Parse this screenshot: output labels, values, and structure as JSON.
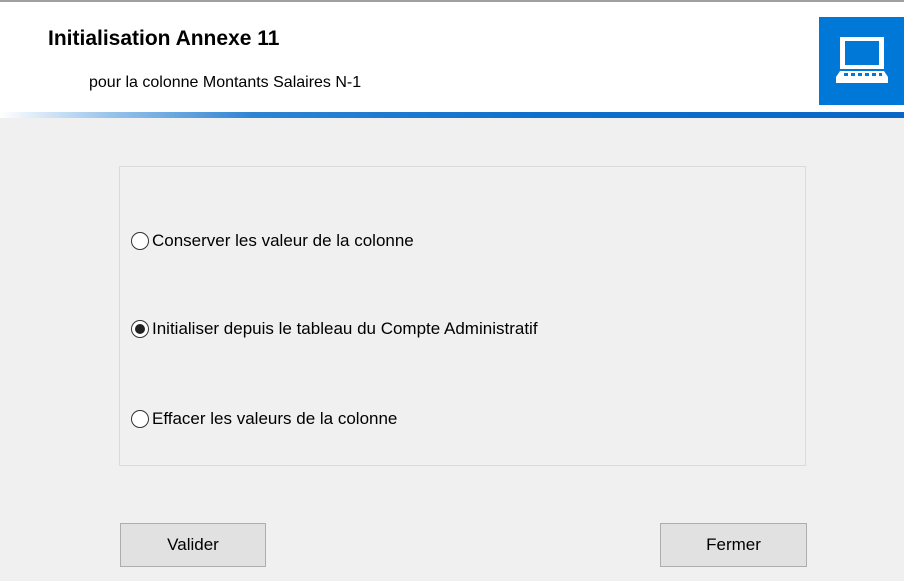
{
  "header": {
    "title": "Initialisation Annexe 11",
    "subtitle": "pour la colonne Montants Salaires N-1",
    "icon": "computer-icon",
    "accent_color": "#0078d7"
  },
  "options": {
    "items": [
      {
        "label": "Conserver les valeur de la colonne",
        "selected": false
      },
      {
        "label": "Initialiser depuis le tableau du Compte Administratif",
        "selected": true
      },
      {
        "label": "Effacer les valeurs de la colonne",
        "selected": false
      }
    ]
  },
  "buttons": {
    "validate_label": "Valider",
    "close_label": "Fermer"
  }
}
